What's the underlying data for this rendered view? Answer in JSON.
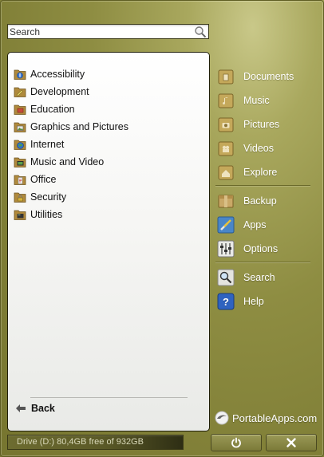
{
  "search": {
    "placeholder": "Search",
    "value": ""
  },
  "categories": [
    {
      "label": "Accessibility",
      "icon": "accessibility-folder-icon"
    },
    {
      "label": "Development",
      "icon": "development-folder-icon"
    },
    {
      "label": "Education",
      "icon": "education-folder-icon"
    },
    {
      "label": "Graphics and Pictures",
      "icon": "graphics-folder-icon"
    },
    {
      "label": "Internet",
      "icon": "internet-folder-icon"
    },
    {
      "label": "Music and Video",
      "icon": "music-video-folder-icon"
    },
    {
      "label": "Office",
      "icon": "office-folder-icon"
    },
    {
      "label": "Security",
      "icon": "security-folder-icon"
    },
    {
      "label": "Utilities",
      "icon": "utilities-folder-icon"
    }
  ],
  "back_label": "Back",
  "menu": {
    "documents": "Documents",
    "music": "Music",
    "pictures": "Pictures",
    "videos": "Videos",
    "explore": "Explore",
    "backup": "Backup",
    "apps": "Apps",
    "options": "Options",
    "search": "Search",
    "help": "Help"
  },
  "brand": "PortableApps.com",
  "drive_status": "Drive (D:) 80,4GB free of 932GB",
  "colors": {
    "accent": "#8e8d42",
    "folder": "#b08a3c",
    "menu_text": "#ffffff"
  }
}
